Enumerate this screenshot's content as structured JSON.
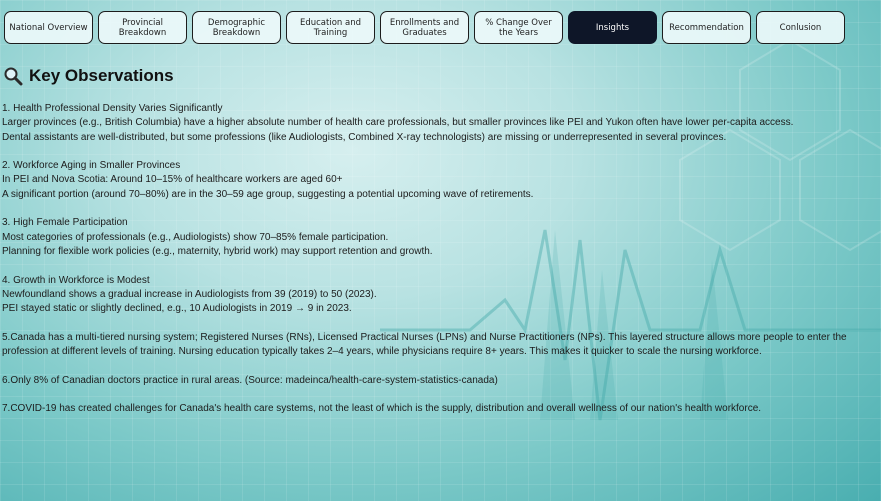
{
  "tabs": [
    {
      "label": "National Overview",
      "active": false
    },
    {
      "label": "Provincial Breakdown",
      "active": false
    },
    {
      "label": "Demographic Breakdown",
      "active": false
    },
    {
      "label": "Education and Training",
      "active": false
    },
    {
      "label": "Enrollments and Graduates",
      "active": false
    },
    {
      "label": "% Change Over the Years",
      "active": false
    },
    {
      "label": "Insights",
      "active": true
    },
    {
      "label": "Recommendation",
      "active": false
    },
    {
      "label": "Conlusion",
      "active": false
    }
  ],
  "colors": {
    "active_tab": "#0e1628",
    "tab_background": "#ebf8fa",
    "background_accent": "#49aeb0"
  },
  "heading": {
    "icon": "magnifier-icon",
    "title": "Key Observations"
  },
  "observations": [
    {
      "lines": [
        "1. Health Professional Density Varies Significantly",
        "Larger provinces (e.g., British Columbia) have a higher absolute number of health care professionals, but smaller provinces like PEI and Yukon often have lower per-capita access.",
        "Dental assistants are well-distributed, but some professions (like Audiologists, Combined X-ray technologists) are missing or underrepresented in several provinces."
      ]
    },
    {
      "lines": [
        "2. Workforce Aging in Smaller Provinces",
        "In PEI and Nova Scotia: Around 10–15% of healthcare workers are aged 60+",
        "A significant portion (around 70–80%) are in the 30–59 age group, suggesting a potential upcoming wave of retirements."
      ]
    },
    {
      "lines": [
        "3. High Female Participation",
        "Most categories of professionals (e.g., Audiologists) show 70–85% female participation.",
        "Planning for flexible work policies (e.g., maternity, hybrid work) may support retention and growth."
      ]
    },
    {
      "lines": [
        "4. Growth in Workforce is Modest",
        "Newfoundland shows a gradual increase in Audiologists from 39 (2019) to 50 (2023).",
        "PEI stayed static or slightly declined, e.g., 10 Audiologists in 2019 → 9 in 2023."
      ]
    },
    {
      "lines": [
        "5.Canada has a multi-tiered nursing system; Registered Nurses (RNs), Licensed Practical Nurses (LPNs) and Nurse Practitioners (NPs). This layered structure allows more people to enter the profession at different levels of training. Nursing education typically takes 2–4 years, while physicians require 8+ years. This makes it quicker to scale the nursing workforce."
      ]
    },
    {
      "lines": [
        "6.Only 8% of Canadian doctors practice in rural areas. (Source: madeinca/health-care-system-statistics-canada)"
      ]
    },
    {
      "lines": [
        "7.COVID-19 has created challenges for Canada's health care systems, not the least of which is the supply, distribution and overall wellness of our nation's health workforce."
      ]
    }
  ]
}
